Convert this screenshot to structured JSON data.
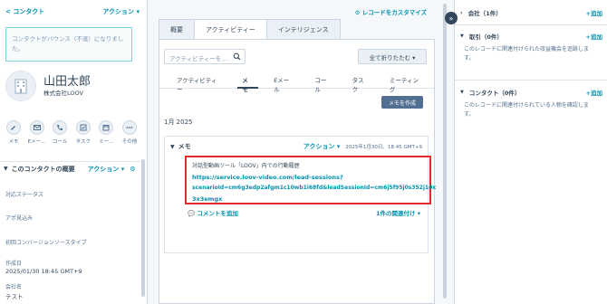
{
  "left": {
    "back_label": "< コンタクト",
    "actions_label": "アクション ▾",
    "bounce_notice": "コンタクトがバウンス（不達）になりました。",
    "name": "山田太郎",
    "company": "株式会社LOOV",
    "quick_actions": [
      {
        "label": "メモ",
        "icon": "note-icon"
      },
      {
        "label": "Eメー…",
        "icon": "email-icon"
      },
      {
        "label": "コール",
        "icon": "phone-icon"
      },
      {
        "label": "タスク",
        "icon": "task-icon"
      },
      {
        "label": "ミー…",
        "icon": "calendar-icon"
      },
      {
        "label": "その他",
        "icon": "more-icon"
      }
    ],
    "overview_title": "このコンタクトの概要",
    "overview_actions": "アクション ▾",
    "properties": [
      {
        "label": "対応ステータス",
        "value": ""
      },
      {
        "label": "アポ見込み",
        "value": ""
      },
      {
        "label": "初回コンバージョンソースタイプ",
        "value": ""
      },
      {
        "label": "作成日",
        "value": "2025/01/30 18:45 GMT+9"
      },
      {
        "label": "会社名",
        "value": "テスト"
      }
    ]
  },
  "middle": {
    "customize_label": "レコードをカスタマイズ",
    "tabs": [
      "概要",
      "アクティビティー",
      "インテリジェンス"
    ],
    "search_placeholder": "アクティビティーを…",
    "collapse_label": "全て折りたたむ ▾",
    "subtabs": [
      "アクティビティー",
      "メモ",
      "Eメール",
      "コール",
      "タスク",
      "ミーティング"
    ],
    "create_memo_label": "メモを作成",
    "month_label": "1月 2025",
    "memo": {
      "title": "メモ",
      "actions_label": "アクション ▾",
      "date": "2025年1月30日、18:45 GMT+9",
      "body_line": "対話型動画ツール「LOOV」内での行動履歴",
      "url_lines": [
        "https://service.loov-video.com/lead-sessions?",
        "scenarioId=cm6g3edp2afgm1c10wb1i68fd&leadSessionId=cm6j5f95j0s352j10x",
        "3x3emgx"
      ],
      "comment_label": "コメントを追加",
      "associations_label": "1件の関連付け ▾"
    }
  },
  "right": {
    "sections": [
      {
        "title": "会社（1件）",
        "add": "+追加",
        "body": ""
      },
      {
        "title": "取引（0件）",
        "add": "+追加",
        "body": "このレコードに関連付けられた収益機会を追跡します。"
      },
      {
        "title": "コンタクト（0件）",
        "add": "+追加",
        "body": "このレコードに関連付けられている人物を確認します。"
      }
    ]
  },
  "colors": {
    "link": "#0091ae",
    "highlight": "#e02b2b",
    "button_dark": "#516f90"
  }
}
